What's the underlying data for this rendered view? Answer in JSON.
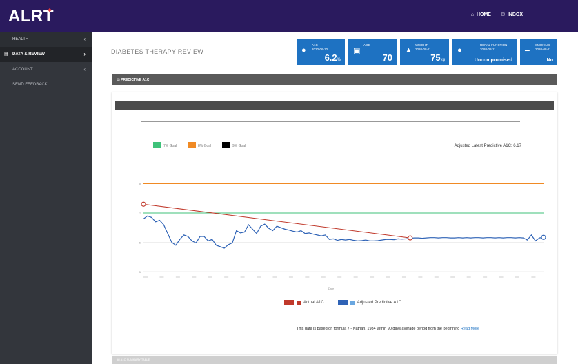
{
  "app": {
    "logo": "ALRT",
    "logo_mark": "✦"
  },
  "topnav": {
    "home": "HOME",
    "inbox": "INBOX"
  },
  "sidebar": [
    {
      "label": "HEALTH",
      "chev": "‹",
      "kind": "head"
    },
    {
      "label": "DATA & REVIEW",
      "chev": "›",
      "kind": "active"
    },
    {
      "label": "ACCOUNT",
      "chev": "‹",
      "kind": "normal"
    },
    {
      "label": "SEND FEEDBACK",
      "chev": "",
      "kind": "normal"
    }
  ],
  "page": {
    "title": "DIABETES THERAPY REVIEW"
  },
  "tiles": [
    {
      "icon": "drop-icon",
      "glyph": "●",
      "label_1": "A1C",
      "label_2": "2020-06-10",
      "value": "6.2",
      "unit": "%",
      "color": "#1e72c2"
    },
    {
      "icon": "calendar-icon",
      "glyph": "▣",
      "label_1": "AGE",
      "label_2": "",
      "value": "70",
      "unit": "",
      "color": "#1e72c2"
    },
    {
      "icon": "scale-icon",
      "glyph": "▲",
      "label_1": "WEIGHT",
      "label_2": "2020-08-11",
      "value": "75",
      "unit": "kg",
      "color": "#1e72c2"
    },
    {
      "icon": "kidney-icon",
      "glyph": "●",
      "label_1": "RENAL FUNCTION",
      "label_2": "2020-08-11",
      "value": "Uncompromised",
      "unit": "",
      "color": "#1e72c2"
    },
    {
      "icon": "smoking-icon",
      "glyph": "━",
      "label_1": "SMOKING",
      "label_2": "2020-08-11",
      "value": "No",
      "unit": "",
      "color": "#1e72c2"
    }
  ],
  "section": {
    "title": "PREDICTIVE A1C"
  },
  "chart_data": {
    "type": "line",
    "legend_top": [
      {
        "name": "7% Goal",
        "color": "#3fc27a"
      },
      {
        "name": "8% Goal",
        "color": "#f08a24"
      },
      {
        "name": "9% Goal",
        "color": "#000000"
      }
    ],
    "annotation": "Adjusted Latest Predictive A1C: 6.17",
    "ylim": [
      5,
      9
    ],
    "goals": [
      {
        "y": 7,
        "color": "#3fc27a"
      },
      {
        "y": 8,
        "color": "#f08a24"
      },
      {
        "y": 9,
        "color": "#000000"
      }
    ],
    "y_ticks": [
      "5",
      "6",
      "7",
      "8"
    ],
    "x_label": "Date",
    "x_count": 100,
    "series": [
      {
        "name": "Actual A1C",
        "color": "#c0392b",
        "points": [
          [
            0,
            7.3
          ],
          [
            66,
            6.15
          ]
        ]
      },
      {
        "name": "Adjusted Predictive A1C",
        "color": "#2f63b6",
        "values": [
          6.8,
          6.9,
          6.85,
          6.7,
          6.75,
          6.6,
          6.3,
          6.0,
          5.9,
          6.1,
          6.25,
          6.2,
          6.05,
          5.98,
          6.2,
          6.2,
          6.05,
          6.1,
          5.9,
          5.85,
          5.8,
          5.92,
          5.98,
          6.4,
          6.32,
          6.35,
          6.6,
          6.45,
          6.3,
          6.55,
          6.62,
          6.48,
          6.4,
          6.55,
          6.5,
          6.45,
          6.42,
          6.38,
          6.35,
          6.4,
          6.3,
          6.32,
          6.28,
          6.25,
          6.22,
          6.25,
          6.1,
          6.12,
          6.07,
          6.1,
          6.08,
          6.1,
          6.07,
          6.05,
          6.06,
          6.08,
          6.05,
          6.05,
          6.06,
          6.08,
          6.1,
          6.1,
          6.09,
          6.12,
          6.11,
          6.12,
          6.14,
          6.15,
          6.15,
          6.14,
          6.15,
          6.16,
          6.16,
          6.15,
          6.16,
          6.16,
          6.15,
          6.15,
          6.16,
          6.15,
          6.16,
          6.15,
          6.16,
          6.16,
          6.15,
          6.16,
          6.16,
          6.15,
          6.16,
          6.15,
          6.16,
          6.16,
          6.15,
          6.16,
          6.15,
          6.08,
          6.25,
          6.05,
          6.15,
          6.17
        ]
      }
    ]
  },
  "chart_legend": [
    {
      "name": "Actual A1C",
      "colors": [
        "#c0392b",
        "#c0392b"
      ]
    },
    {
      "name": "Adjusted Predictive A1C",
      "colors": [
        "#2f63b6",
        "#6aa7e0"
      ]
    }
  ],
  "footnote": {
    "text": "This data is based on formula 7 - Nathan, 1984 within 90 days average period from the beginning",
    "link": "Read More"
  },
  "bottom_section": {
    "title": "A1C SUMMARY TABLE"
  }
}
